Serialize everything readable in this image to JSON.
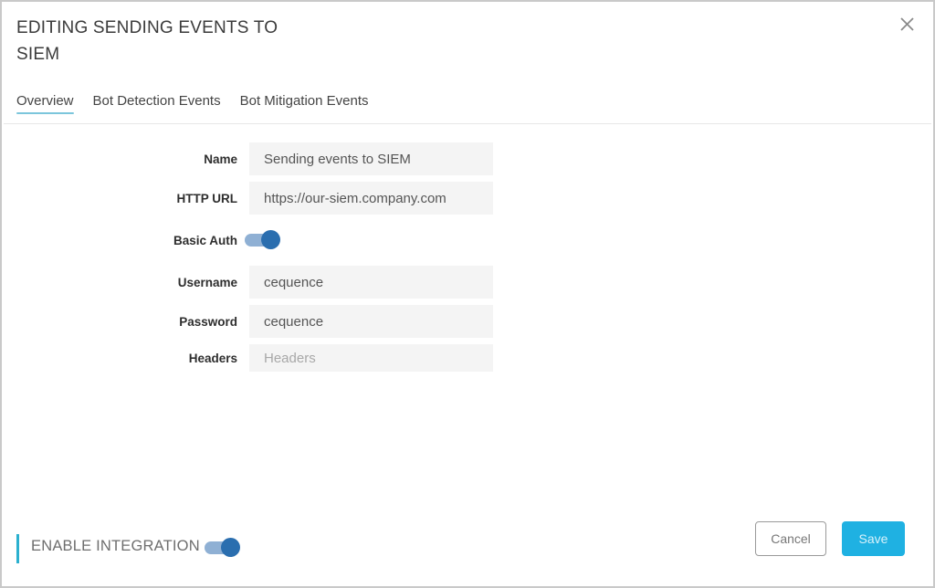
{
  "dialog": {
    "title": "EDITING SENDING EVENTS TO SIEM",
    "close_icon": "close-icon"
  },
  "tabs": [
    {
      "label": "Overview",
      "active": true
    },
    {
      "label": "Bot Detection Events",
      "active": false
    },
    {
      "label": "Bot Mitigation Events",
      "active": false
    }
  ],
  "form": {
    "name": {
      "label": "Name",
      "value": "Sending events to SIEM",
      "placeholder": ""
    },
    "http_url": {
      "label": "HTTP URL",
      "value": "https://our-siem.company.com",
      "placeholder": ""
    },
    "basic_auth": {
      "label": "Basic Auth",
      "enabled": true
    },
    "username": {
      "label": "Username",
      "value": "cequence",
      "placeholder": ""
    },
    "password": {
      "label": "Password",
      "value": "cequence",
      "placeholder": ""
    },
    "headers": {
      "label": "Headers",
      "value": "",
      "placeholder": "Headers"
    }
  },
  "footer": {
    "enable_integration_label": "ENABLE INTEGRATION",
    "enable_integration_on": true,
    "cancel_label": "Cancel",
    "save_label": "Save"
  },
  "colors": {
    "accent": "#2bb0cf",
    "save_button": "#1fb1e2",
    "toggle_knob": "#2a6eaf",
    "toggle_track": "#8fb0d4",
    "tab_underline": "#7cc6dc"
  }
}
